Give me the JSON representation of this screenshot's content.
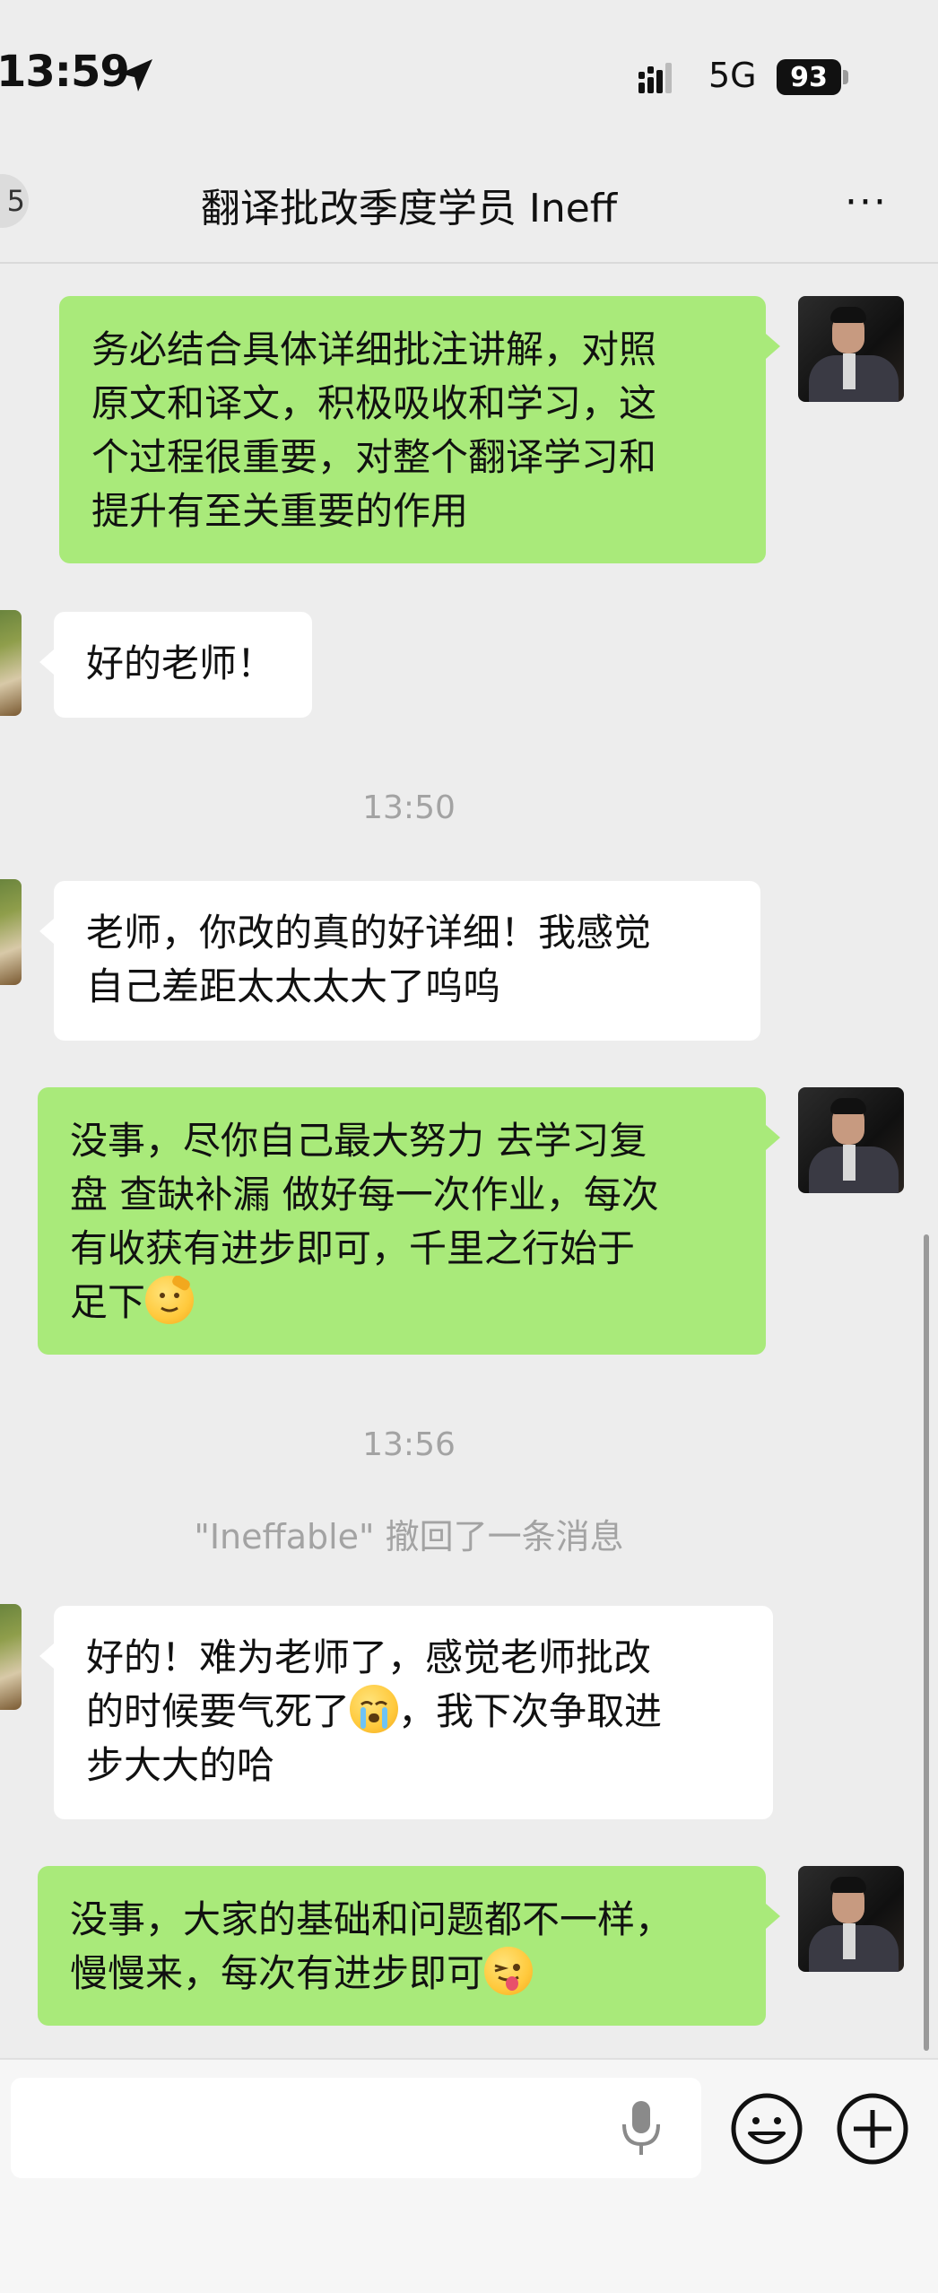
{
  "status_bar": {
    "time": "13:59",
    "network": "5G",
    "battery": "93"
  },
  "header": {
    "back_badge": "5",
    "title": "翻译批改季度学员  Ineff",
    "more_label": "···"
  },
  "messages": [
    {
      "sender": "me",
      "lines": [
        "务必结合具体详细批注讲解，对照",
        "原文和译文，积极吸收和学习，这",
        "个过程很重要，对整个翻译学习和",
        "提升有至关重要的作用"
      ]
    },
    {
      "sender": "them",
      "lines": [
        "好的老师！"
      ]
    },
    {
      "type": "time",
      "text": "13:50"
    },
    {
      "sender": "them",
      "lines": [
        "老师，你改的真的好详细！我感觉",
        "自己差距太太太大了呜呜"
      ]
    },
    {
      "sender": "me",
      "lines": [
        "没事，尽你自己最大努力 去学习复",
        "盘 查缺补漏 做好每一次作业，每次",
        "有收获有进步即可，千里之行始于",
        "足下"
      ],
      "emoji": "saluting-face-emoji"
    },
    {
      "type": "time",
      "text": "13:56"
    },
    {
      "type": "system",
      "text": "\"Ineffable\" 撤回了一条消息"
    },
    {
      "sender": "them",
      "lines": [
        "好的！难为老师了，感觉老师批改",
        "的时候要气死了",
        "，我下次争取进",
        "步大大的哈"
      ],
      "emoji": "crying-face-emoji"
    },
    {
      "sender": "me",
      "lines": [
        "没事，大家的基础和问题都不一样，",
        "慢慢来，每次有进步即可"
      ],
      "emoji": "winking-tongue-emoji"
    }
  ],
  "icons": {
    "location": "location-arrow-icon",
    "signal": "signal-bars-icon",
    "mic": "microphone-icon",
    "emoji": "smiley-icon",
    "plus": "plus-circle-icon"
  },
  "colors": {
    "my_bubble": "#a9ea7a",
    "their_bubble": "#ffffff",
    "background": "#ededed"
  }
}
